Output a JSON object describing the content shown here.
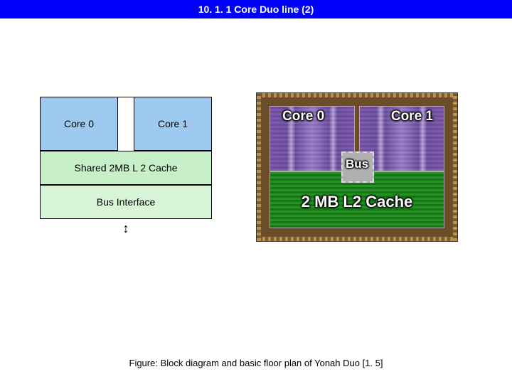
{
  "header": {
    "title": "10. 1. 1 Core Duo line (2)"
  },
  "block_diagram": {
    "core0": "Core 0",
    "core1": "Core 1",
    "l2_cache": "Shared 2MB L 2 Cache",
    "bus_interface": "Bus Interface",
    "arrow_glyph": "↕"
  },
  "die": {
    "core0": "Core 0",
    "core1": "Core 1",
    "bus": "Bus",
    "cache": "2 MB L2 Cache"
  },
  "caption": "Figure: Block diagram and basic floor plan of Yonah Duo [1. 5]"
}
